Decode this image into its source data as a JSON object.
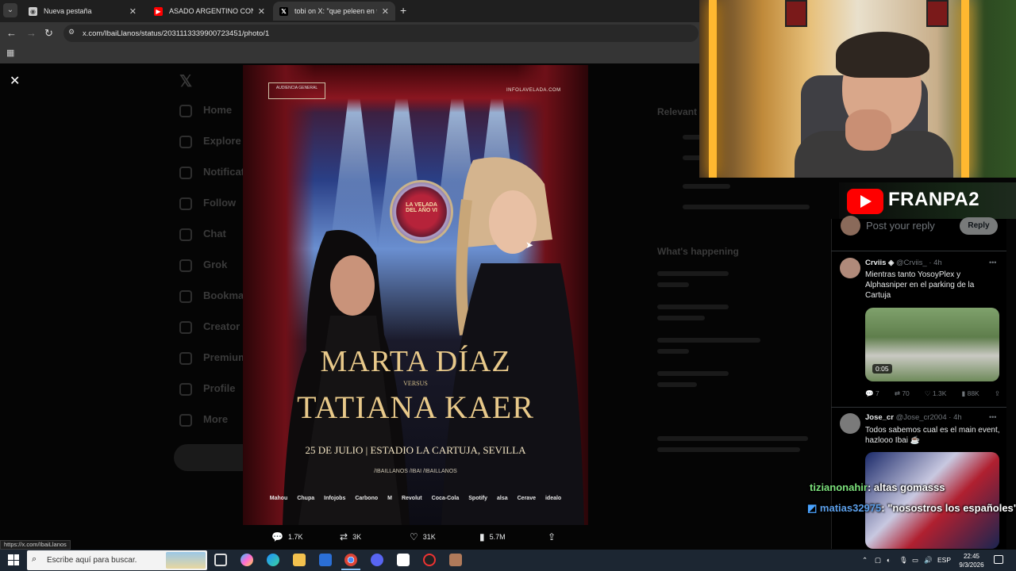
{
  "browser": {
    "tabs": [
      {
        "title": "Nueva pestaña",
        "active": false
      },
      {
        "title": "ASADO ARGENTINO CON COS",
        "active": false
      },
      {
        "title": "tobi on X: \"que peleen en tang",
        "active": true
      }
    ],
    "url": "x.com/IbaiLlanos/status/2031113339900723451/photo/1",
    "status_url": "https://x.com/IbaiLlanos"
  },
  "poster": {
    "audience_label": "AUDIENCIA GENERAL",
    "site": "INFOLAVELADA.COM",
    "seal_text": "LA VELADA DEL AÑO VI",
    "fighter1": "MARTA DÍAZ",
    "versus": "VERSUS",
    "fighter2": "TATIANA KAER",
    "date_venue": "25 DE JULIO | ESTADIO LA CARTUJA, SEVILLA",
    "handles": "/IBAILLANOS   /IBAI   /IBAILLANOS",
    "sponsors": [
      "Mahou",
      "Chupa",
      "Infojobs",
      "Carbono",
      "M",
      "Revolut",
      "Coca-Cola",
      "Spotify",
      "alsa",
      "Cerave",
      "idealo"
    ]
  },
  "stats": {
    "replies": "1.7K",
    "reposts": "3K",
    "likes": "31K",
    "views": "5.7M"
  },
  "stream": {
    "channel": "FRANPA2"
  },
  "reply_box": {
    "placeholder": "Post your reply",
    "button": "Reply"
  },
  "posts": [
    {
      "name": "Crviis",
      "handle": "@Crviis_",
      "time": "4h",
      "text": "Mientras tanto YosoyPlex y Alphasniper en el parking de la Cartuja",
      "video_duration": "0:05",
      "replies": "7",
      "reposts": "70",
      "likes": "1.3K",
      "views": "88K"
    },
    {
      "name": "Jose_cr",
      "handle": "@Jose_cr2004",
      "time": "4h",
      "text": "Todos sabemos cual es el main event, hazlooo Ibai ☕"
    }
  ],
  "chat": [
    {
      "user": "tizianonahir",
      "message": ": altas gomasss",
      "color": "#7be07b"
    },
    {
      "user": "matias32975",
      "message": ": \"nosostros los españoles\"?",
      "color": "#5b9ee8"
    }
  ],
  "taskbar": {
    "search_placeholder": "Escribe aquí para buscar.",
    "lang": "ESP",
    "time": "22:45",
    "date": "9/3/2026"
  },
  "colors": {
    "x_bg": "#000000",
    "taskbar": "#1c2632",
    "chrome": "#353535",
    "youtube_red": "#ff0000"
  }
}
